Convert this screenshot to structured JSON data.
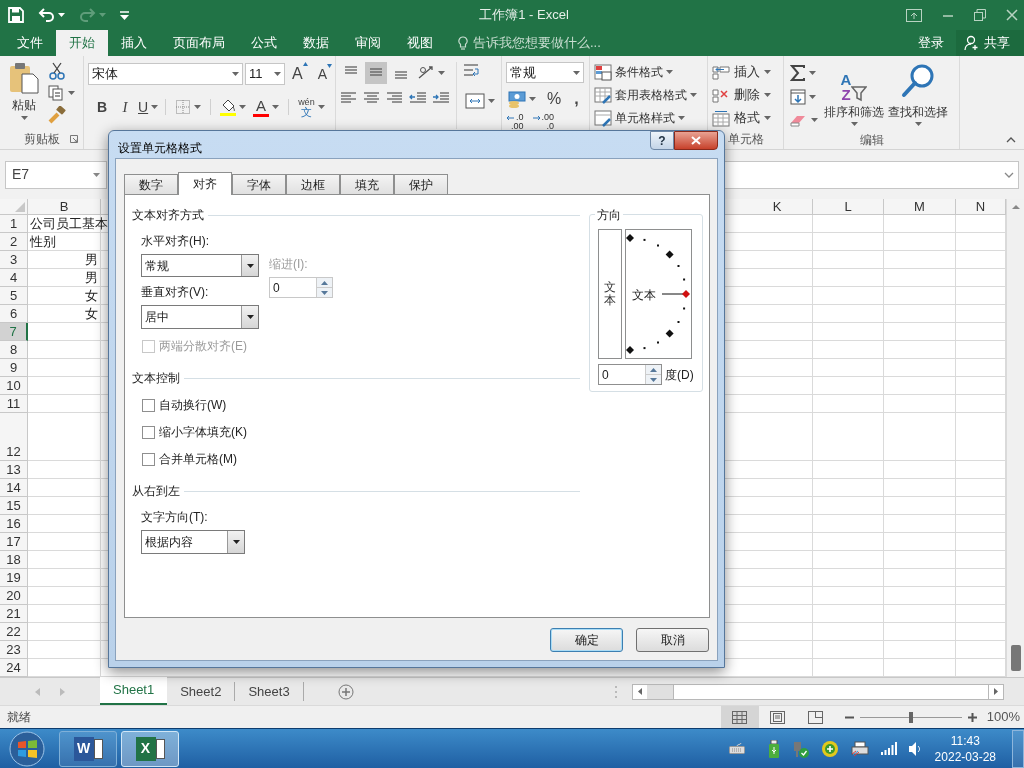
{
  "title_bar": {
    "title": "工作簿1 - Excel"
  },
  "menu_tabs": [
    {
      "label": "文件",
      "selected": false
    },
    {
      "label": "开始",
      "selected": true
    },
    {
      "label": "插入",
      "selected": false
    },
    {
      "label": "页面布局",
      "selected": false
    },
    {
      "label": "公式",
      "selected": false
    },
    {
      "label": "数据",
      "selected": false
    },
    {
      "label": "审阅",
      "selected": false
    },
    {
      "label": "视图",
      "selected": false
    }
  ],
  "tell_me": {
    "placeholder": "告诉我您想要做什么..."
  },
  "account": {
    "sign_in": "登录",
    "share": "共享"
  },
  "ribbon": {
    "clipboard": {
      "paste": "粘贴",
      "label": "剪贴板"
    },
    "font": {
      "name": "宋体",
      "size": "11",
      "grow": "A",
      "shrink": "A",
      "bold": "B",
      "italic": "I",
      "underline": "U",
      "font_color": "A",
      "phonetic_top": "wén",
      "phonetic_bottom": "文"
    },
    "alignment": {
      "vertical_align": [
        {
          "selected": false
        },
        {
          "selected": true
        },
        {
          "selected": false
        }
      ]
    },
    "number": {
      "format": "常规",
      "percent": "%",
      "comma": ",",
      "increase_decimal": [
        ".0",
        ".00"
      ],
      "decrease_decimal": [
        ".00",
        ".0"
      ]
    },
    "styles": [
      {
        "label": "条件格式"
      },
      {
        "label": "套用表格格式"
      },
      {
        "label": "单元格样式"
      }
    ],
    "cells": {
      "items": [
        {
          "label": "插入"
        },
        {
          "label": "删除"
        },
        {
          "label": "格式"
        }
      ],
      "label": "单元格"
    },
    "editing": {
      "sort_letters": [
        "A",
        "Z"
      ],
      "sort": "排序和筛选",
      "find": "查找和选择",
      "label": "编辑"
    }
  },
  "name_box": {
    "value": "E7"
  },
  "columns": [
    {
      "label": "B",
      "selected": false
    },
    {
      "label": "K",
      "selected": false
    },
    {
      "label": "L",
      "selected": false
    },
    {
      "label": "M",
      "selected": false
    },
    {
      "label": "N",
      "selected": false
    }
  ],
  "rows": [
    {
      "label": "1",
      "kind": "normal",
      "selected": false,
      "cells": [
        {
          "text": "公司员工基本",
          "right_aligned": false
        }
      ]
    },
    {
      "label": "2",
      "kind": "normal",
      "selected": false,
      "cells": [
        {
          "text": "性别",
          "right_aligned": false
        }
      ]
    },
    {
      "label": "3",
      "kind": "normal",
      "selected": false,
      "cells": [
        {
          "text": "男",
          "right_aligned": true
        }
      ]
    },
    {
      "label": "4",
      "kind": "normal",
      "selected": false,
      "cells": [
        {
          "text": "男",
          "right_aligned": true
        }
      ]
    },
    {
      "label": "5",
      "kind": "normal",
      "selected": false,
      "cells": [
        {
          "text": "女",
          "right_aligned": true
        }
      ]
    },
    {
      "label": "6",
      "kind": "normal",
      "selected": false,
      "cells": [
        {
          "text": "女",
          "right_aligned": true
        }
      ]
    },
    {
      "label": "7",
      "kind": "normal",
      "selected": true
    },
    {
      "label": "8",
      "kind": "normal",
      "selected": false
    },
    {
      "label": "9",
      "kind": "normal",
      "selected": false
    },
    {
      "label": "10",
      "kind": "normal",
      "selected": false
    },
    {
      "label": "11",
      "kind": "normal",
      "selected": false
    },
    {
      "label": "12",
      "kind": "tall",
      "selected": false
    },
    {
      "label": "13",
      "kind": "normal",
      "selected": false
    },
    {
      "label": "14",
      "kind": "normal",
      "selected": false
    },
    {
      "label": "15",
      "kind": "normal",
      "selected": false
    },
    {
      "label": "16",
      "kind": "normal",
      "selected": false
    },
    {
      "label": "17",
      "kind": "normal",
      "selected": false
    },
    {
      "label": "18",
      "kind": "normal",
      "selected": false
    },
    {
      "label": "19",
      "kind": "normal",
      "selected": false
    },
    {
      "label": "20",
      "kind": "normal",
      "selected": false
    },
    {
      "label": "21",
      "kind": "normal",
      "selected": false
    },
    {
      "label": "22",
      "kind": "normal",
      "selected": false
    },
    {
      "label": "23",
      "kind": "normal",
      "selected": false
    },
    {
      "label": "24",
      "kind": "normal",
      "selected": false
    }
  ],
  "sheet_tabs": [
    {
      "label": "Sheet1",
      "selected": true
    },
    {
      "label": "Sheet2",
      "selected": false
    },
    {
      "label": "Sheet3",
      "selected": false
    }
  ],
  "status_bar": {
    "status": "就绪",
    "views": [
      {
        "selected": true
      },
      {
        "selected": false
      },
      {
        "selected": false
      }
    ],
    "zoom": {
      "level": 0.5
    },
    "zoom_text": "100%"
  },
  "taskbar": {
    "apps": [
      {
        "letter": "W",
        "selected": false
      },
      {
        "letter": "X",
        "selected": true
      }
    ],
    "time": "11:43",
    "date": "2022-03-28"
  },
  "dialog": {
    "title": "设置单元格格式",
    "help": "?",
    "tabs": [
      {
        "label": "数字",
        "selected": false
      },
      {
        "label": "对齐",
        "selected": true
      },
      {
        "label": "字体",
        "selected": false
      },
      {
        "label": "边框",
        "selected": false
      },
      {
        "label": "填充",
        "selected": false
      },
      {
        "label": "保护",
        "selected": false
      }
    ],
    "text_alignment": {
      "heading": "文本对齐方式",
      "horizontal": {
        "label": "水平对齐(H):",
        "value": "常规"
      },
      "indent": {
        "label": "缩进(I):",
        "value": "0",
        "disabled": true
      },
      "vertical": {
        "label": "垂直对齐(V):",
        "value": "居中"
      },
      "distributed": {
        "label": "两端分散对齐(E)",
        "checked": false,
        "disabled": true
      }
    },
    "text_control": {
      "heading": "文本控制",
      "options": [
        {
          "label": "自动换行(W)",
          "checked": false
        },
        {
          "label": "缩小字体填充(K)",
          "checked": false
        },
        {
          "label": "合并单元格(M)",
          "checked": false
        }
      ]
    },
    "right_to_left": {
      "heading": "从右到左",
      "direction": {
        "label": "文字方向(T):",
        "value": "根据内容"
      }
    },
    "orientation": {
      "heading": "方向",
      "vertical_text": "文本",
      "dial_text": "文本",
      "degrees": "0",
      "degrees_label": "度(D)"
    },
    "buttons": [
      {
        "label": "确定",
        "default": true
      },
      {
        "label": "取消",
        "default": false
      }
    ]
  }
}
